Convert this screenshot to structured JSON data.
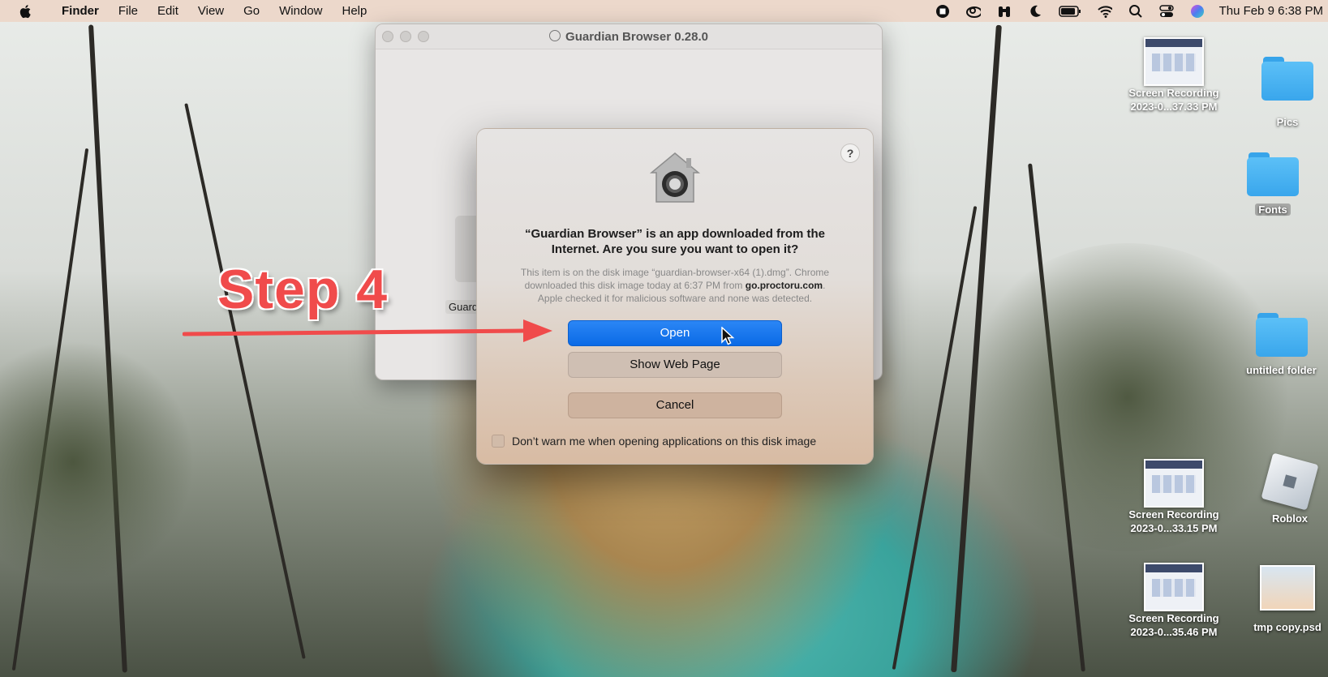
{
  "menubar": {
    "app_name": "Finder",
    "menus": [
      "File",
      "Edit",
      "View",
      "Go",
      "Window",
      "Help"
    ],
    "clock": "Thu Feb 9  6:38 PM",
    "status_icons": [
      "stop-record-icon",
      "creative-cloud-icon",
      "binoculars-icon",
      "moon-icon",
      "battery-icon",
      "wifi-icon",
      "search-icon",
      "control-center-icon",
      "siri-icon"
    ]
  },
  "background_window": {
    "title": "Guardian Browser 0.28.0",
    "app_label": "Guard"
  },
  "dialog": {
    "heading": "“Guardian Browser” is an app downloaded from the Internet. Are you sure you want to open it?",
    "info_line1": "This item is on the disk image “guardian-browser-x64 (1).dmg”. Chrome",
    "info_line2_pre": "downloaded this disk image today at 6:37 PM from ",
    "info_domain": "go.proctoru.com",
    "info_line2_post": ".",
    "info_line3": "Apple checked it for malicious software and none was detected.",
    "help_label": "?",
    "open_label": "Open",
    "show_web_page_label": "Show Web Page",
    "cancel_label": "Cancel",
    "checkbox_label": "Don’t warn me when opening applications on this disk image",
    "checkbox_checked": false
  },
  "annotation": {
    "text": "Step 4",
    "color": "#f04b4b"
  },
  "desktop": {
    "icons": [
      {
        "label1": "Screen Recording",
        "label2": "2023-0...37.33 PM"
      },
      {
        "label1": "Pics"
      },
      {
        "label1": "Fonts"
      },
      {
        "label1": "untitled folder"
      },
      {
        "label1": "Screen Recording",
        "label2": "2023-0...33.15 PM"
      },
      {
        "label1": "Roblox"
      },
      {
        "label1": "Screen Recording",
        "label2": "2023-0...35.46 PM"
      },
      {
        "label1": "tmp copy.psd"
      }
    ]
  },
  "colors": {
    "primary_button": "#0a6ae6",
    "folder_blue": "#39a6ec"
  }
}
